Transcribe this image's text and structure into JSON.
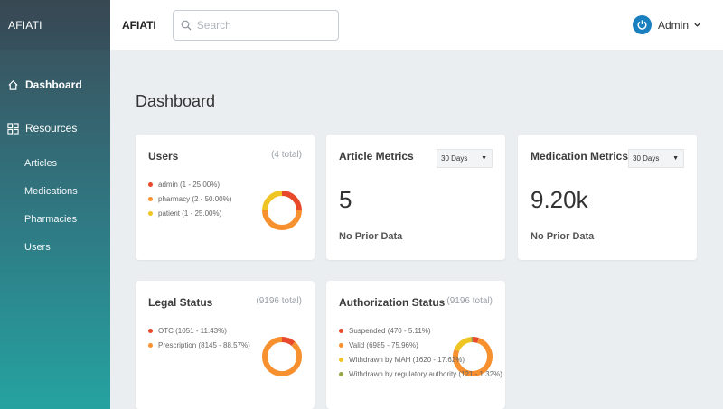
{
  "sidebar": {
    "brand": "AFIATI",
    "nav": [
      {
        "label": "Dashboard"
      },
      {
        "label": "Resources"
      }
    ],
    "sub_items": [
      {
        "label": "Articles"
      },
      {
        "label": "Medications"
      },
      {
        "label": "Pharmacies"
      },
      {
        "label": "Users"
      }
    ]
  },
  "topbar": {
    "brand": "AFIATI",
    "search_placeholder": "Search",
    "user_name": "Admin"
  },
  "page": {
    "title": "Dashboard"
  },
  "colors": {
    "red": "#e8492a",
    "orange": "#f7902f",
    "yellow": "#efc523",
    "olive": "#9aa64b"
  },
  "cards": {
    "users": {
      "title": "Users",
      "total": "(4 total)",
      "legend": [
        {
          "label": "admin (1 - 25.00%)",
          "value": 25.0,
          "color": "#e8492a"
        },
        {
          "label": "pharmacy (2 - 50.00%)",
          "value": 50.0,
          "color": "#f7902f"
        },
        {
          "label": "patient (1 - 25.00%)",
          "value": 25.0,
          "color": "#efc523"
        }
      ]
    },
    "article_metrics": {
      "title": "Article Metrics",
      "range": "30 Days",
      "value": "5",
      "sub": "No Prior Data"
    },
    "medication_metrics": {
      "title": "Medication Metrics",
      "range": "30 Days",
      "value": "9.20k",
      "sub": "No Prior Data"
    },
    "legal_status": {
      "title": "Legal Status",
      "total": "(9196 total)",
      "legend": [
        {
          "label": "OTC (1051 - 11.43%)",
          "value": 11.43,
          "color": "#e8492a"
        },
        {
          "label": "Prescription (8145 - 88.57%)",
          "value": 88.57,
          "color": "#f7902f"
        }
      ]
    },
    "authorization_status": {
      "title": "Authorization Status",
      "total": "(9196 total)",
      "legend": [
        {
          "label": "Suspended (470 - 5.11%)",
          "value": 5.11,
          "color": "#e8492a"
        },
        {
          "label": "Valid (6985 - 75.96%)",
          "value": 75.96,
          "color": "#f7902f"
        },
        {
          "label": "Withdrawn by MAH (1620 - 17.62%)",
          "value": 17.62,
          "color": "#efc523"
        },
        {
          "label": "Withdrawn by regulatory authority (121 - 1.32%)",
          "value": 1.32,
          "color": "#9aa64b"
        }
      ]
    }
  }
}
